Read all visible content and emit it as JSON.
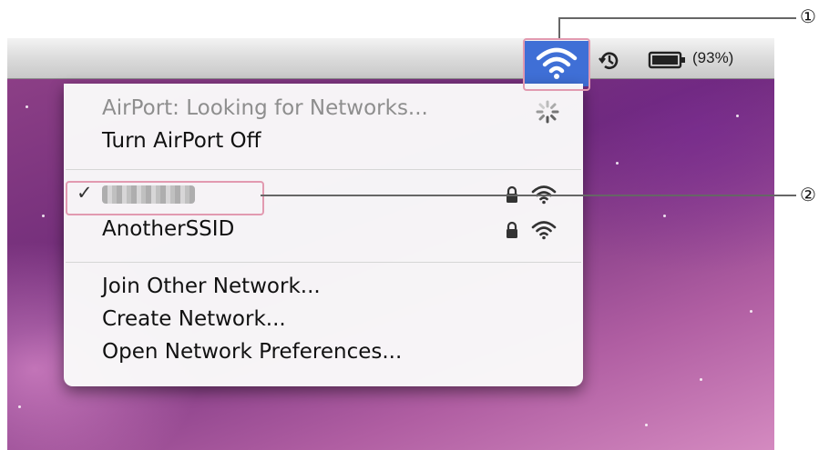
{
  "status_bar": {
    "battery_percent": "(93%)",
    "airport_icon": "wifi-icon",
    "time_machine_icon": "time-machine-icon",
    "battery_icon": "battery-icon"
  },
  "menu": {
    "status_line": "AirPort: Looking for Networks...",
    "turn_off": "Turn AirPort Off",
    "networks": [
      {
        "name": "",
        "selected": true,
        "locked": true,
        "check": "✓"
      },
      {
        "name": "AnotherSSID",
        "selected": false,
        "locked": true
      }
    ],
    "join_other": "Join Other Network...",
    "create_network": "Create Network...",
    "open_prefs": "Open Network Preferences..."
  },
  "callouts": [
    "①",
    "②"
  ],
  "colors": {
    "highlight": "#3f6fd6",
    "callout_box": "#e29ab0"
  }
}
